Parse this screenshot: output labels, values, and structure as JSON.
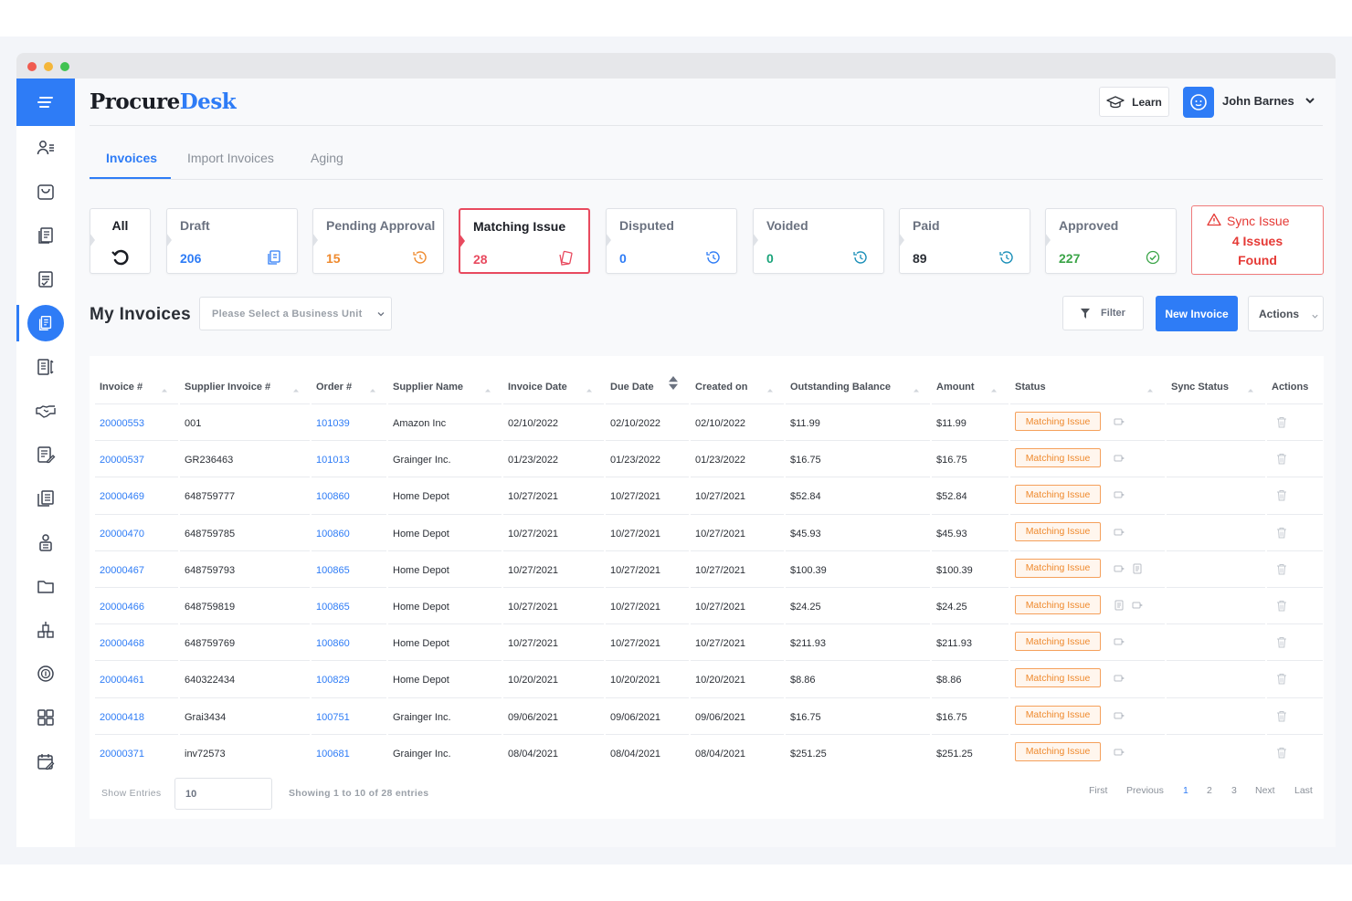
{
  "app": {
    "logo_part1": "Procure",
    "logo_part2": "Desk"
  },
  "header": {
    "learn_label": "Learn",
    "user_name": "John Barnes"
  },
  "tabs": [
    {
      "label": "Invoices",
      "active": true
    },
    {
      "label": "Import Invoices",
      "active": false
    },
    {
      "label": "Aging",
      "active": false
    }
  ],
  "cards": {
    "all": {
      "label": "All"
    },
    "draft": {
      "label": "Draft",
      "count": "206",
      "color": "#2e7cf6"
    },
    "pending": {
      "label": "Pending Approval",
      "count": "15",
      "color": "#ef8a2e"
    },
    "matching": {
      "label": "Matching Issue",
      "count": "28",
      "color": "#e84a5f"
    },
    "disputed": {
      "label": "Disputed",
      "count": "0",
      "color": "#2e7cf6"
    },
    "voided": {
      "label": "Voided",
      "count": "0",
      "color": "#1aa37a"
    },
    "paid": {
      "label": "Paid",
      "count": "89",
      "color": "#2b2f36"
    },
    "approved": {
      "label": "Approved",
      "count": "227",
      "color": "#3aa447"
    },
    "sync": {
      "title": "Sync Issue",
      "line1": "4 Issues",
      "line2": "Found"
    }
  },
  "toolbar": {
    "title": "My Invoices",
    "business_unit_placeholder": "Please Select a Business Unit",
    "filter_label": "Filter",
    "new_invoice_label": "New Invoice",
    "actions_label": "Actions"
  },
  "table": {
    "columns": [
      "Invoice #",
      "Supplier Invoice #",
      "Order #",
      "Supplier Name",
      "Invoice Date",
      "Due Date",
      "Created on",
      "Outstanding Balance",
      "Amount",
      "Status",
      "Sync Status",
      "Actions"
    ],
    "rows": [
      {
        "invoice": "20000553",
        "supplier_invoice": "001",
        "order": "101039",
        "supplier": "Amazon Inc",
        "invoice_date": "02/10/2022",
        "due_date": "02/10/2022",
        "created_on": "02/10/2022",
        "balance": "$11.99",
        "amount": "$11.99",
        "status": "Matching Issue"
      },
      {
        "invoice": "20000537",
        "supplier_invoice": "GR236463",
        "order": "101013",
        "supplier": "Grainger Inc.",
        "invoice_date": "01/23/2022",
        "due_date": "01/23/2022",
        "created_on": "01/23/2022",
        "balance": "$16.75",
        "amount": "$16.75",
        "status": "Matching Issue"
      },
      {
        "invoice": "20000469",
        "supplier_invoice": "648759777",
        "order": "100860",
        "supplier": "Home Depot",
        "invoice_date": "10/27/2021",
        "due_date": "10/27/2021",
        "created_on": "10/27/2021",
        "balance": "$52.84",
        "amount": "$52.84",
        "status": "Matching Issue"
      },
      {
        "invoice": "20000470",
        "supplier_invoice": "648759785",
        "order": "100860",
        "supplier": "Home Depot",
        "invoice_date": "10/27/2021",
        "due_date": "10/27/2021",
        "created_on": "10/27/2021",
        "balance": "$45.93",
        "amount": "$45.93",
        "status": "Matching Issue"
      },
      {
        "invoice": "20000467",
        "supplier_invoice": "648759793",
        "order": "100865",
        "supplier": "Home Depot",
        "invoice_date": "10/27/2021",
        "due_date": "10/27/2021",
        "created_on": "10/27/2021",
        "balance": "$100.39",
        "amount": "$100.39",
        "status": "Matching Issue"
      },
      {
        "invoice": "20000466",
        "supplier_invoice": "648759819",
        "order": "100865",
        "supplier": "Home Depot",
        "invoice_date": "10/27/2021",
        "due_date": "10/27/2021",
        "created_on": "10/27/2021",
        "balance": "$24.25",
        "amount": "$24.25",
        "status": "Matching Issue"
      },
      {
        "invoice": "20000468",
        "supplier_invoice": "648759769",
        "order": "100860",
        "supplier": "Home Depot",
        "invoice_date": "10/27/2021",
        "due_date": "10/27/2021",
        "created_on": "10/27/2021",
        "balance": "$211.93",
        "amount": "$211.93",
        "status": "Matching Issue"
      },
      {
        "invoice": "20000461",
        "supplier_invoice": "640322434",
        "order": "100829",
        "supplier": "Home Depot",
        "invoice_date": "10/20/2021",
        "due_date": "10/20/2021",
        "created_on": "10/20/2021",
        "balance": "$8.86",
        "amount": "$8.86",
        "status": "Matching Issue"
      },
      {
        "invoice": "20000418",
        "supplier_invoice": "Grai3434",
        "order": "100751",
        "supplier": "Grainger Inc.",
        "invoice_date": "09/06/2021",
        "due_date": "09/06/2021",
        "created_on": "09/06/2021",
        "balance": "$16.75",
        "amount": "$16.75",
        "status": "Matching Issue"
      },
      {
        "invoice": "20000371",
        "supplier_invoice": "inv72573",
        "order": "100681",
        "supplier": "Grainger Inc.",
        "invoice_date": "08/04/2021",
        "due_date": "08/04/2021",
        "created_on": "08/04/2021",
        "balance": "$251.25",
        "amount": "$251.25",
        "status": "Matching Issue"
      }
    ]
  },
  "footer": {
    "show_entries_label": "Show Entries",
    "entries_value": "10",
    "showing_text": "Showing 1 to 10 of 28 entries",
    "pagination": [
      "First",
      "Previous",
      "1",
      "2",
      "3",
      "Next",
      "Last"
    ],
    "current_page": "1"
  },
  "colors": {
    "accent": "#2e7cf6",
    "warning": "#ef8a2e",
    "danger": "#e53935"
  }
}
